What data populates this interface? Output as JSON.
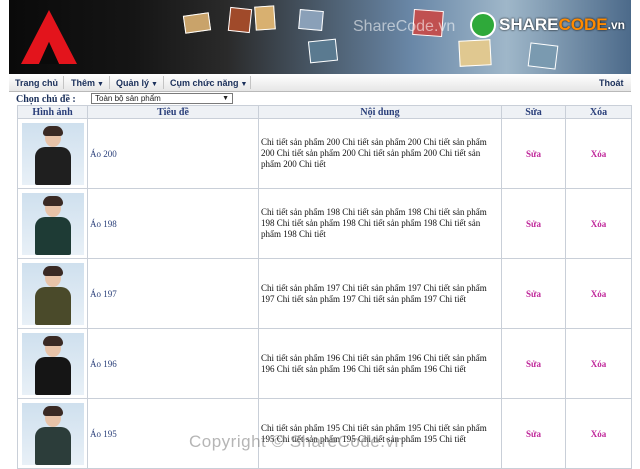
{
  "banner": {
    "watermark": "ShareCode.vn",
    "brand_part1": "SHARE",
    "brand_part2": "CODE",
    "brand_part3": ".vn"
  },
  "menu": {
    "items": [
      "Trang chủ",
      "Thêm",
      "Quản lý",
      "Cụm chức năng"
    ],
    "logout": "Thoát"
  },
  "filter": {
    "label": "Chọn chủ đề :",
    "selected": "Toàn bộ sản phẩm"
  },
  "table": {
    "headers": [
      "Hình ảnh",
      "Tiêu đề",
      "Nội dung",
      "Sửa",
      "Xóa"
    ],
    "rows": [
      {
        "title": "Áo 200",
        "content": "Chi tiết sản phẩm 200 Chi tiết sản phẩm 200 Chi tiết sản phẩm 200 Chi tiết sản phẩm 200 Chi tiết sản phẩm 200 Chi tiết sản phẩm 200 Chi tiết",
        "edit": "Sửa",
        "delete": "Xóa",
        "shirt_color": "#1f1f1f"
      },
      {
        "title": "Áo 198",
        "content": "Chi tiết sản phẩm 198 Chi tiết sản phẩm 198 Chi tiết sản phẩm 198 Chi tiết sản phẩm 198 Chi tiết sản phẩm 198 Chi tiết sản phẩm 198 Chi tiết",
        "edit": "Sửa",
        "delete": "Xóa",
        "shirt_color": "#1e3b35"
      },
      {
        "title": "Áo 197",
        "content": "Chi tiết sản phẩm 197 Chi tiết sản phẩm 197 Chi tiết sản phẩm 197 Chi tiết sản phẩm 197 Chi tiết sản phẩm 197 Chi tiết",
        "edit": "Sửa",
        "delete": "Xóa",
        "shirt_color": "#4a4a2a"
      },
      {
        "title": "Áo 196",
        "content": "Chi tiết sản phẩm 196 Chi tiết sản phẩm 196 Chi tiết sản phẩm 196 Chi tiết sản phẩm 196 Chi tiết sản phẩm 196 Chi tiết",
        "edit": "Sửa",
        "delete": "Xóa",
        "shirt_color": "#151515"
      },
      {
        "title": "Áo 195",
        "content": "Chi tiết sản phẩm 195 Chi tiết sản phẩm 195 Chi tiết sản phẩm 195 Chi tiết sản phẩm 195 Chi tiết sản phẩm 195 Chi tiết",
        "edit": "Sửa",
        "delete": "Xóa",
        "shirt_color": "#2c3d3a"
      }
    ]
  },
  "footer": {
    "watermark": "Copyright © ShareCode.vn"
  }
}
